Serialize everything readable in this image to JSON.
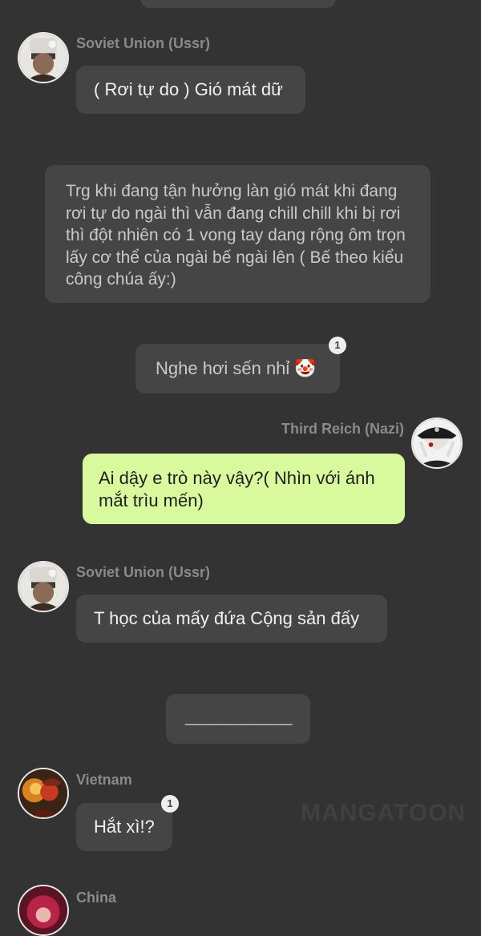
{
  "messages": {
    "m1": {
      "sender": "Soviet Union (Ussr)",
      "text": "( Rơi tự do ) Gió mát dữ"
    },
    "m2": {
      "text": "Trg khi đang tận hưởng làn gió mát khi đang rơi tự do ngài thì vẫn đang chill chill khi bị rơi thì đột nhiên có 1 vong tay dang rộng ôm trọn lấy cơ thể của ngài bế ngài lên ( Bế theo kiểu công chúa ấy:)"
    },
    "m3": {
      "text": "Nghe hơi sến nhỉ 🤡",
      "badge": "1"
    },
    "m4": {
      "sender": "Third Reich (Nazi)",
      "text": "Ai dậy e trò này vậy?( Nhìn với ánh mắt trìu mến)"
    },
    "m5": {
      "sender": "Soviet Union (Ussr)",
      "text": "T học của mấy đứa Cộng sản đấy"
    },
    "m6": {
      "text": "____________"
    },
    "m7": {
      "sender": "Vietnam",
      "text": "Hắt xì!?",
      "badge": "1"
    },
    "m8": {
      "sender": "China"
    }
  },
  "watermark": "MANGATOON",
  "colors": {
    "background": "#333333",
    "bubble": "#454545",
    "own_bubble": "#d9f99d"
  }
}
